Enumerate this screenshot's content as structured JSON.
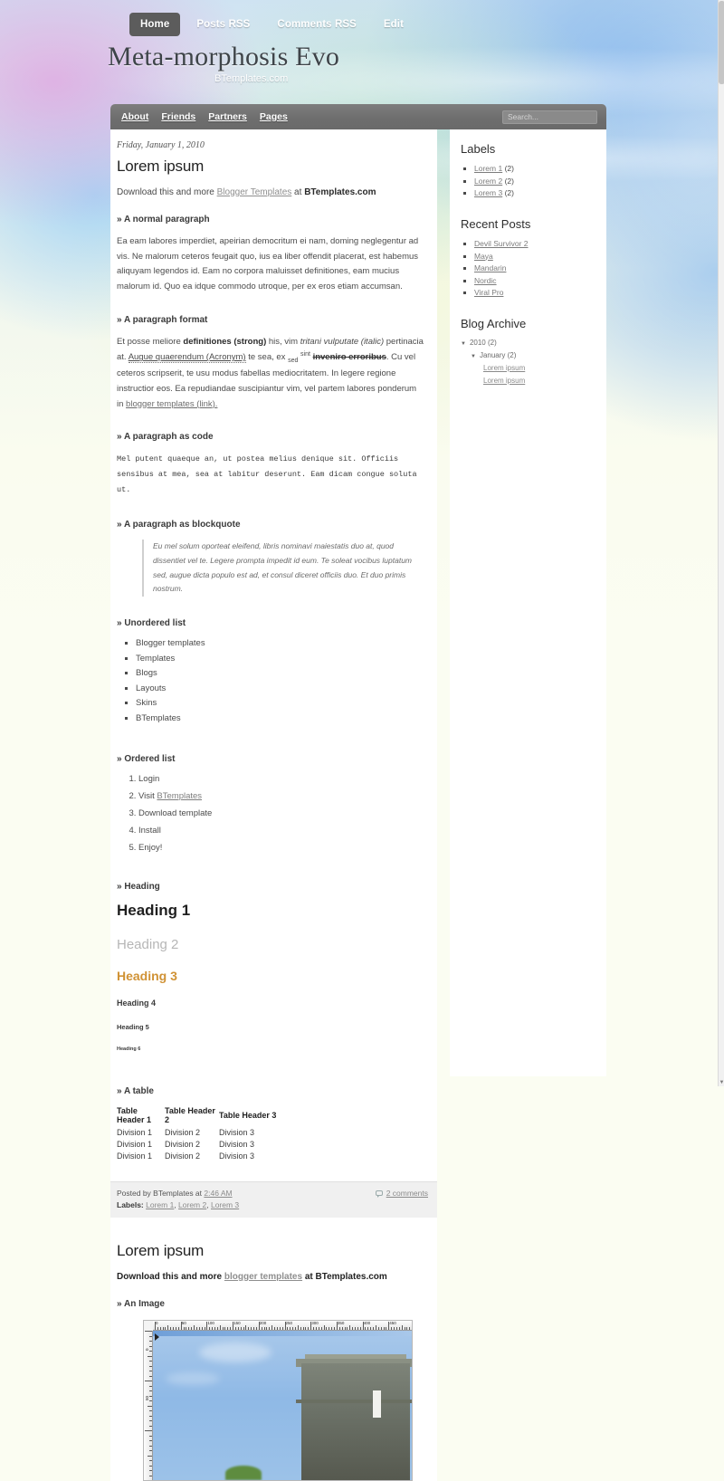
{
  "topnav": {
    "items": [
      {
        "label": "Home",
        "active": true
      },
      {
        "label": "Posts RSS",
        "active": false
      },
      {
        "label": "Comments RSS",
        "active": false
      },
      {
        "label": "Edit",
        "active": false
      }
    ]
  },
  "header": {
    "title": "Meta-morphosis Evo",
    "subtitle": "BTemplates.com"
  },
  "menubar": {
    "links": [
      "About",
      "Friends",
      "Partners",
      "Pages"
    ],
    "search_placeholder": "Search...",
    "search_value": ""
  },
  "post1": {
    "date": "Friday, January 1, 2010",
    "title": "Lorem ipsum",
    "download_prefix": "Download this and more ",
    "download_link": "Blogger Templates",
    "download_mid": " at ",
    "download_site": "BTemplates.com",
    "sec_normal": "» A normal paragraph",
    "normal_text": "Ea eam labores imperdiet, apeirian democritum ei nam, doming neglegentur ad vis. Ne malorum ceteros feugait quo, ius ea liber offendit placerat, est habemus aliquyam legendos id. Eam no corpora maluisset definitiones, eam mucius malorum id. Quo ea idque commodo utroque, per ex eros etiam accumsan.",
    "sec_format": "» A paragraph format",
    "format_p1": "Et posse meliore ",
    "format_strong": "definitiones (strong)",
    "format_p2": " his, vim ",
    "format_italic": "tritani vulputate (italic)",
    "format_p3": " pertinacia at. ",
    "format_acronym": "Augue quaerendum (Acronym)",
    "format_p4": " te sea, ex ",
    "format_sub": "sed",
    "format_sup": "sint",
    "format_del": "inveniro erroribus",
    "format_p5": ". Cu vel ceteros scripserit, te usu modus fabellas mediocritatem. In legere regione instructior eos. Ea repudiandae suscipiantur vim, vel partem labores ponderum in ",
    "format_link": "blogger templates (link).",
    "sec_code": "» A paragraph as code",
    "code_text": "Mel putent quaeque an, ut postea melius denique sit. Officiis sensibus at mea, sea at labitur deserunt. Eam dicam congue soluta ut.",
    "sec_blockquote": "» A paragraph as blockquote",
    "blockquote_text": "Eu mel solum oporteat eleifend, libris nominavi maiestatis duo at, quod dissentiet vel te. Legere prompta impedit id eum. Te soleat vocibus luptatum sed, augue dicta populo est ad, et consul diceret officiis duo. Et duo primis nostrum.",
    "sec_ul": "» Unordered list",
    "ul_items": [
      "Blogger templates",
      "Templates",
      "Blogs",
      "Layouts",
      "Skins",
      "BTemplates"
    ],
    "sec_ol": "» Ordered list",
    "ol_items": [
      "Login",
      "Visit ",
      "Download template",
      "Install",
      "Enjoy!"
    ],
    "ol_link": "BTemplates",
    "sec_heading": "» Heading",
    "h1": "Heading 1",
    "h2": "Heading 2",
    "h3": "Heading 3",
    "h4": "Heading 4",
    "h5": "Heading 5",
    "h6": "Heading 6",
    "sec_table": "» A table",
    "table_headers": [
      "Table Header 1",
      "Table Header 2",
      "Table Header 3"
    ],
    "table_rows": [
      [
        "Division 1",
        "Division 2",
        "Division 3"
      ],
      [
        "Division 1",
        "Division 2",
        "Division 3"
      ],
      [
        "Division 1",
        "Division 2",
        "Division 3"
      ]
    ],
    "footer_posted": "Posted by BTemplates at ",
    "footer_time": "2:46 AM",
    "footer_labels_prefix": "Labels: ",
    "footer_labels": [
      "Lorem 1",
      "Lorem 2",
      "Lorem 3"
    ],
    "footer_comments": "2 comments"
  },
  "post2": {
    "title": "Lorem ipsum",
    "download_prefix": "Download this and more ",
    "download_link": "blogger templates",
    "download_mid": " at ",
    "download_site": "BTemplates.com",
    "sec_image": "» An Image",
    "ruler_numbers": [
      "0",
      "50",
      "100",
      "150",
      "200",
      "250",
      "300",
      "350",
      "400",
      "450"
    ],
    "ruler_v_numbers": [
      "0",
      "50"
    ]
  },
  "sidebar": {
    "labels_title": "Labels",
    "labels": [
      {
        "name": "Lorem 1",
        "count": "(2)"
      },
      {
        "name": "Lorem 2",
        "count": "(2)"
      },
      {
        "name": "Lorem 3",
        "count": "(2)"
      }
    ],
    "recent_title": "Recent Posts",
    "recent": [
      "Devil Survivor 2",
      "Maya",
      "Mandarin",
      "Nordic",
      "Viral Pro"
    ],
    "archive_title": "Blog Archive",
    "archive": [
      {
        "level": 1,
        "arrow": "▼",
        "label": "2010 (2)",
        "link": false
      },
      {
        "level": 2,
        "arrow": "▼",
        "label": "January (2)",
        "link": false
      },
      {
        "level": 3,
        "arrow": "",
        "label": "Lorem ipsum",
        "link": true
      },
      {
        "level": 3,
        "arrow": "",
        "label": "Lorem ipsum",
        "link": true
      }
    ]
  },
  "colors": {
    "accent_orange": "#d09235",
    "menubar_gray": "#6e6e6e",
    "active_tab": "#5c5c5c",
    "footer_bg": "#f0f0f0"
  }
}
